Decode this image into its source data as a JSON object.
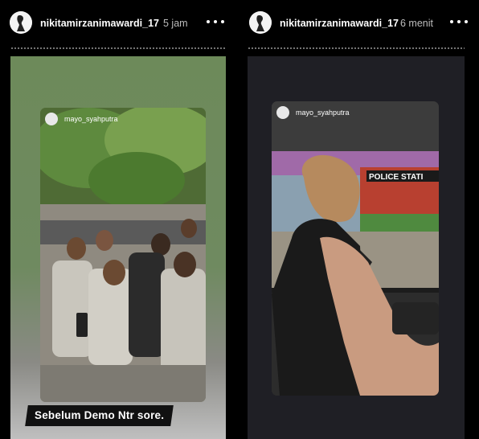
{
  "stories": [
    {
      "username": "nikitamirzanimawardi_17",
      "time": "5 jam",
      "post_username": "mayo_syahputra",
      "overlay_text": "Sebelum Demo Ntr sore."
    },
    {
      "username": "nikitamirzanimawardi_17",
      "time": "6 menit",
      "post_username": "mayo_syahputra",
      "sign_text": "POLICE STATI"
    }
  ],
  "icons": {
    "avatar": "avatar-icon",
    "more": "more-options-icon"
  }
}
